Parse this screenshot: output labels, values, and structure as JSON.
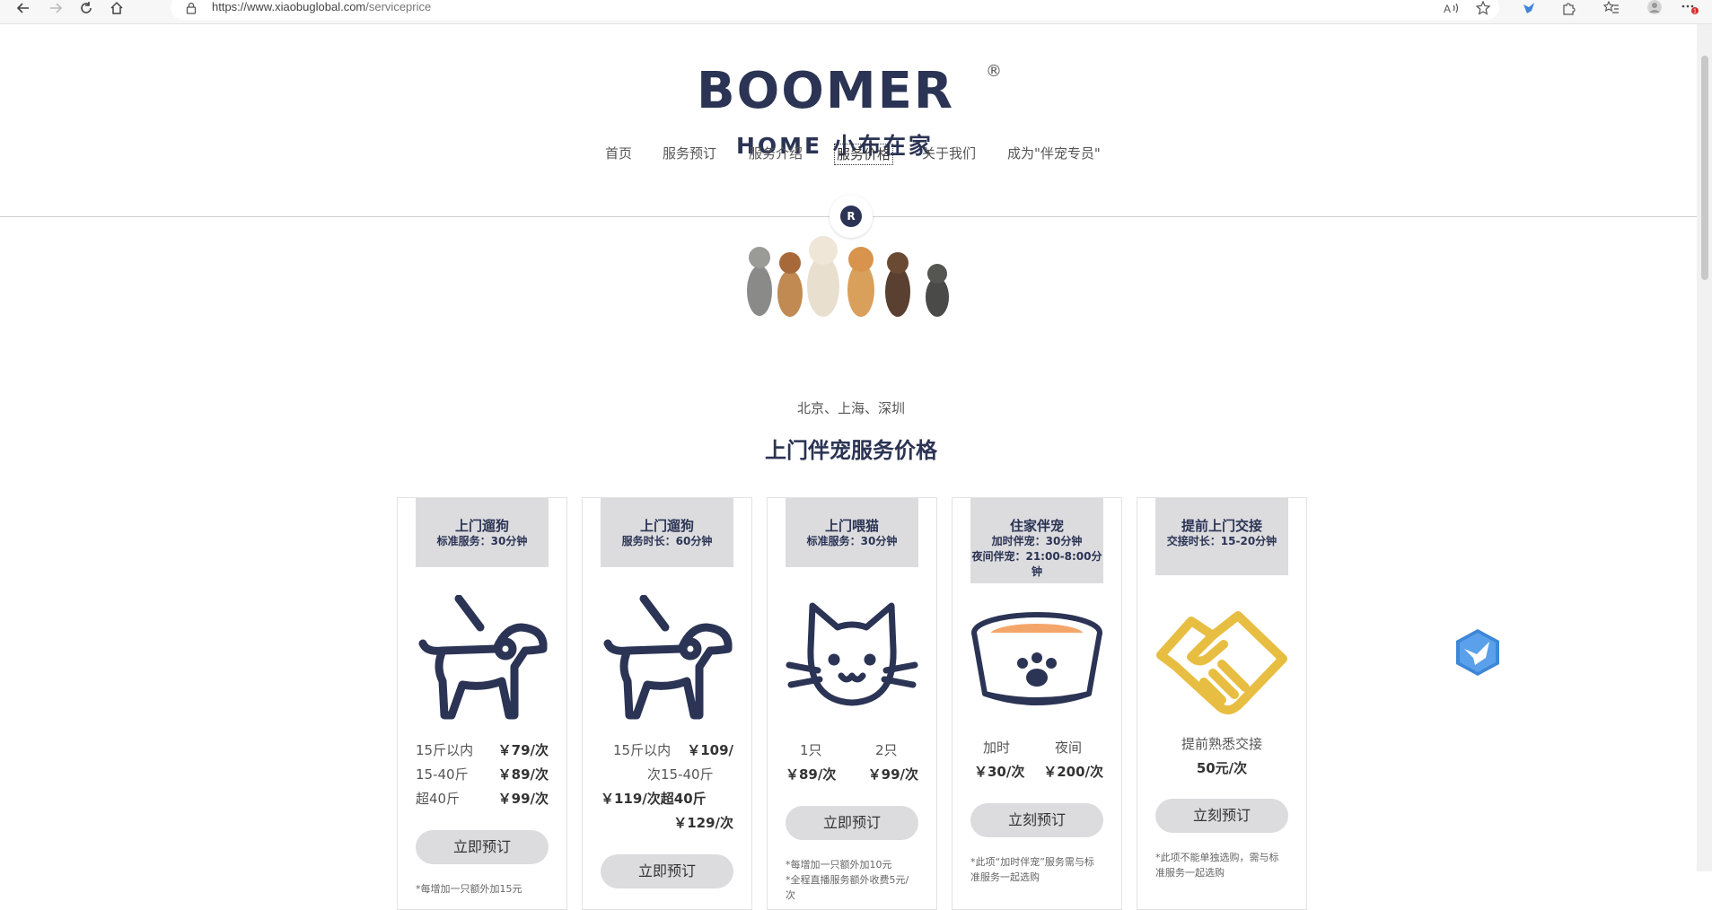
{
  "browser": {
    "url_host": "https://www.xiaobuglobal.com",
    "url_path": "/serviceprice",
    "notification_count": "1"
  },
  "logo": {
    "main": "BOOMER",
    "registered": "®",
    "sub": "HOME 小布在家",
    "badge": "R"
  },
  "nav": {
    "items": [
      "首页",
      "服务预订",
      "服务介绍",
      "服务价格",
      "关于我们",
      "成为\"伴宠专员\""
    ]
  },
  "hero": {
    "cities": "北京、上海、深圳",
    "title": "上门伴宠服务价格"
  },
  "cards": [
    {
      "title": "上门遛狗",
      "sub1": "标准服务：30分钟",
      "icon": "dog-walk-icon",
      "rows": [
        {
          "label": "15斤以内",
          "price": "￥79/次"
        },
        {
          "label": "15-40斤",
          "price": "￥89/次"
        },
        {
          "label": "超40斤",
          "price": "￥99/次"
        }
      ],
      "button": "立即预订",
      "note": "*每增加一只额外加15元"
    },
    {
      "title": "上门遛狗",
      "sub1": "服务时长：60分钟",
      "icon": "dog-walk-icon",
      "line1a": "15斤以内",
      "line1b": "￥109/",
      "line2": "次15-40斤",
      "line3": "￥119/次超40斤",
      "line4": "￥129/次",
      "button": "立即预订"
    },
    {
      "title": "上门喂猫",
      "sub1": "标准服务：30分钟",
      "icon": "cat-face-icon",
      "col_labels": [
        "1只",
        "2只"
      ],
      "col_prices": [
        "￥89/次",
        "￥99/次"
      ],
      "button": "立即预订",
      "note": "*每增加一只额外加10元\n*全程直播服务额外收费5元/次"
    },
    {
      "title": "住家伴宠",
      "sub1": "加时伴宠：30分钟",
      "sub2": "夜间伴宠：21:00-8:00分钟",
      "icon": "pet-bowl-icon",
      "col_labels": [
        "加时",
        "夜间"
      ],
      "col_prices": [
        "￥30/次",
        "￥200/次"
      ],
      "button": "立刻预订",
      "note": "*此项“加时伴宠”服务需与标准服务一起选购"
    },
    {
      "title": "提前上门交接",
      "sub1": "交接时长：15-20分钟",
      "icon": "handshake-icon",
      "line1": "提前熟悉交接",
      "line2": "50元/次",
      "button": "立刻预订",
      "note": "*此项不能单独选购，需与标准服务一起选购"
    }
  ],
  "colors": {
    "brand_navy": "#2b3454",
    "card_head_bg": "#dcdcdf",
    "bowl_orange": "#f4a66a",
    "handshake_gold": "#e8be42",
    "bird_blue": "#3d86d8"
  }
}
